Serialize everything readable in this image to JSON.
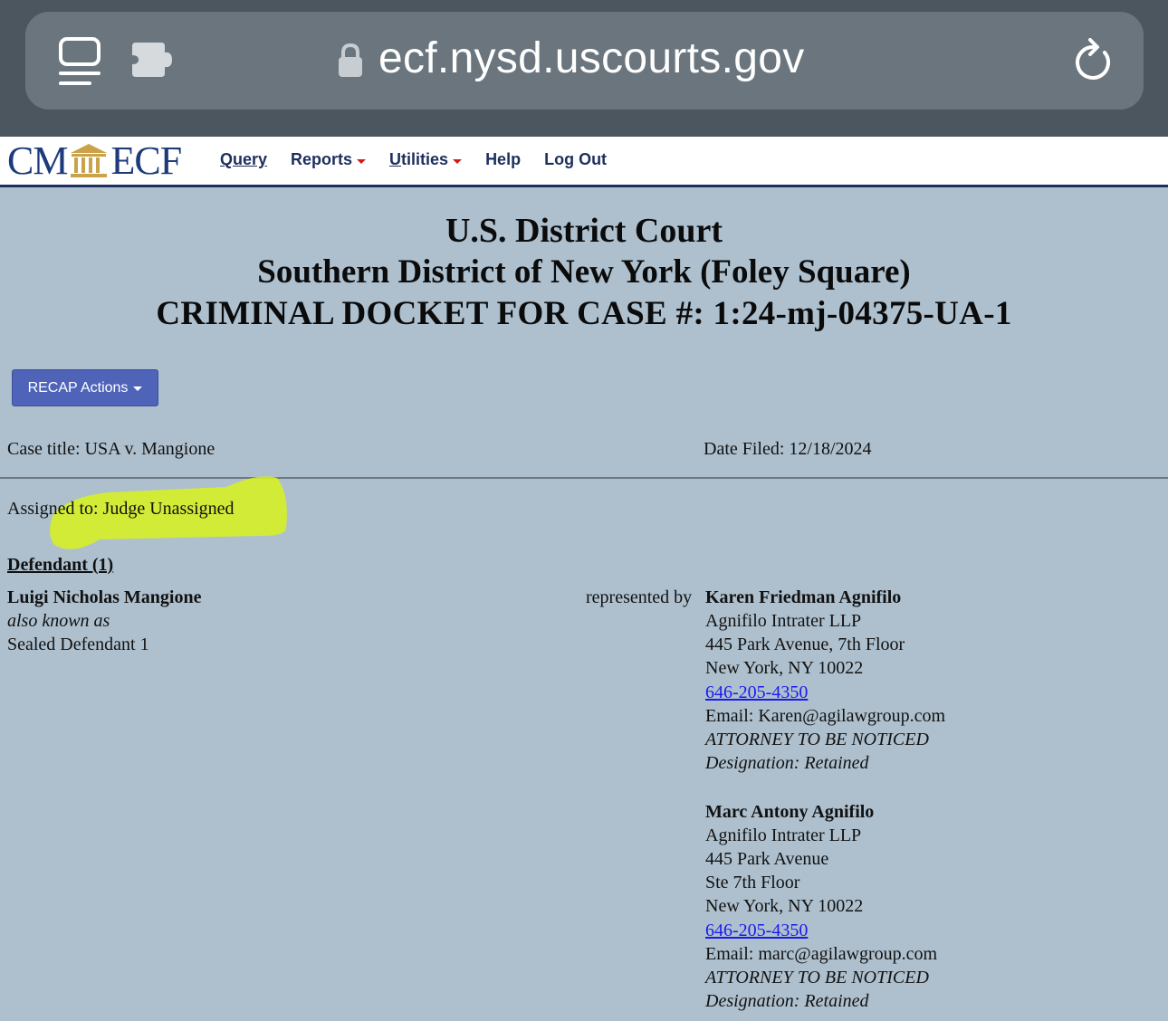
{
  "browser": {
    "url": "ecf.nysd.uscourts.gov"
  },
  "nav": {
    "logo_left": "CM",
    "logo_right": "ECF",
    "items": [
      {
        "label": "Query",
        "dropdown": false
      },
      {
        "label": "Reports",
        "dropdown": true
      },
      {
        "label": "Utilities",
        "dropdown": true
      },
      {
        "label": "Help",
        "dropdown": false
      },
      {
        "label": "Log Out",
        "dropdown": false
      }
    ]
  },
  "header": {
    "court": "U.S. District Court",
    "district": "Southern District of New York (Foley Square)",
    "docket": "CRIMINAL DOCKET FOR CASE #: 1:24-mj-04375-UA-1"
  },
  "recap": {
    "label": "RECAP Actions"
  },
  "case": {
    "title": "Case title: USA v. Mangione",
    "date_filed": "Date Filed: 12/18/2024",
    "assigned": "Assigned to: Judge Unassigned"
  },
  "defendant": {
    "heading": "Defendant (1)",
    "name": "Luigi Nicholas Mangione",
    "aka_label": "also known as",
    "aka": "Sealed Defendant 1",
    "represented_by": "represented by"
  },
  "attorneys": [
    {
      "name": "Karen Friedman Agnifilo",
      "lines": [
        "Agnifilo Intrater LLP",
        "445 Park Avenue, 7th Floor",
        "New York, NY 10022"
      ],
      "phone": "646-205-4350",
      "email": "Email: Karen@agilawgroup.com",
      "notice": "ATTORNEY TO BE NOTICED",
      "designation": "Designation: Retained"
    },
    {
      "name": "Marc Antony Agnifilo",
      "lines": [
        "Agnifilo Intrater LLP",
        "445 Park Avenue",
        "Ste 7th Floor",
        "New York, NY 10022"
      ],
      "phone": "646-205-4350",
      "email": "Email: marc@agilawgroup.com",
      "notice": "ATTORNEY TO BE NOTICED",
      "designation": "Designation: Retained"
    }
  ],
  "colors": {
    "page_bg": "#aec0ce",
    "chrome_bg": "#4b565e",
    "urlbar_bg": "#6a757d",
    "nav_text": "#1d2f5e",
    "recap_btn": "#4f64b9",
    "link": "#1a1aee",
    "highlight": "#d8f21c"
  },
  "icons": [
    "tabs-overview-icon",
    "extension-puzzle-icon",
    "lock-icon",
    "reload-icon",
    "courthouse-icon"
  ]
}
